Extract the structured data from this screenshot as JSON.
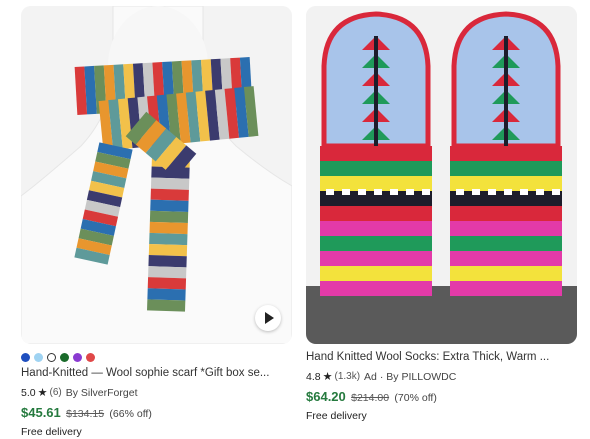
{
  "listings": [
    {
      "image_alt": "Hand-knitted striped wool scarf on white mannequin",
      "swatches": [
        "#1f4fbf",
        "#9fd3f2",
        "#ffffff",
        "#1a6b2b",
        "#8a3bd1",
        "#e04848"
      ],
      "title": "Hand-Knitted — Wool sophie scarf *Gift box se...",
      "rating": "5.0",
      "review_count": "(6)",
      "seller": "By SilverForget",
      "price": "$45.61",
      "original_price": "$134.15",
      "discount": "(66% off)",
      "delivery": "Free delivery",
      "has_video": true
    },
    {
      "image_alt": "Hand knitted patterned wool socks with red, green and blue designs",
      "title": "Hand Knitted Wool Socks: Extra Thick, Warm ...",
      "rating": "4.8",
      "review_count": "(1.3k)",
      "ad_label": "Ad",
      "seller": "· By PILLOWDC",
      "price": "$64.20",
      "original_price": "$214.00",
      "discount": "(70% off)",
      "delivery": "Free delivery"
    }
  ],
  "icons": {
    "star": "star-icon",
    "play": "play-icon"
  },
  "colors": {
    "price": "#257a3e",
    "scarf_stripes": [
      "#d93a3a",
      "#2b6fb0",
      "#6b8f5a",
      "#e8962e",
      "#5e9a9a",
      "#f2c14a",
      "#3b3b6e",
      "#c8c8c8"
    ],
    "sock_colors": [
      "#a8c4ea",
      "#d9283b",
      "#1f9a5a",
      "#e33aa8",
      "#f3e23c",
      "#1d1d2b",
      "#ffffff"
    ]
  }
}
